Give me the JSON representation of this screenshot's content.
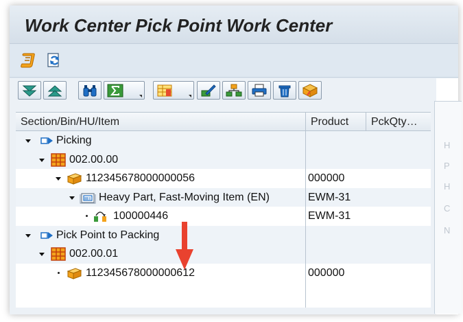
{
  "window": {
    "title": "Work Center Pick Point Work Center"
  },
  "grid": {
    "columns": [
      "Section/Bin/HU/Item",
      "Product",
      "PckQty…"
    ],
    "rows": [
      {
        "label": "Picking",
        "product": ""
      },
      {
        "label": "002.00.00",
        "product": ""
      },
      {
        "label": "112345678000000056",
        "product": "000000"
      },
      {
        "label": "Heavy Part, Fast-Moving Item (EN)",
        "product": "EWM-31"
      },
      {
        "label": "100000446",
        "product": "EWM-31"
      },
      {
        "label": "Pick Point to Packing",
        "product": ""
      },
      {
        "label": "002.00.01",
        "product": ""
      },
      {
        "label": "112345678000000612",
        "product": "000000"
      }
    ]
  },
  "icons": {
    "app_toolbar": [
      "script-icon",
      "refresh-icon"
    ],
    "tree_toolbar": [
      "expand-all-icon",
      "collapse-all-icon",
      "find-icon",
      "sum-icon",
      "layout-icon",
      "edit-icon",
      "hierarchy-icon",
      "print-icon",
      "delete-icon",
      "pack-icon"
    ],
    "annotation": "red-arrow-icon"
  },
  "colors": {
    "accent": "#e9422f",
    "selection_blue": "#1f6fc5",
    "orange": "#f2a31b"
  }
}
